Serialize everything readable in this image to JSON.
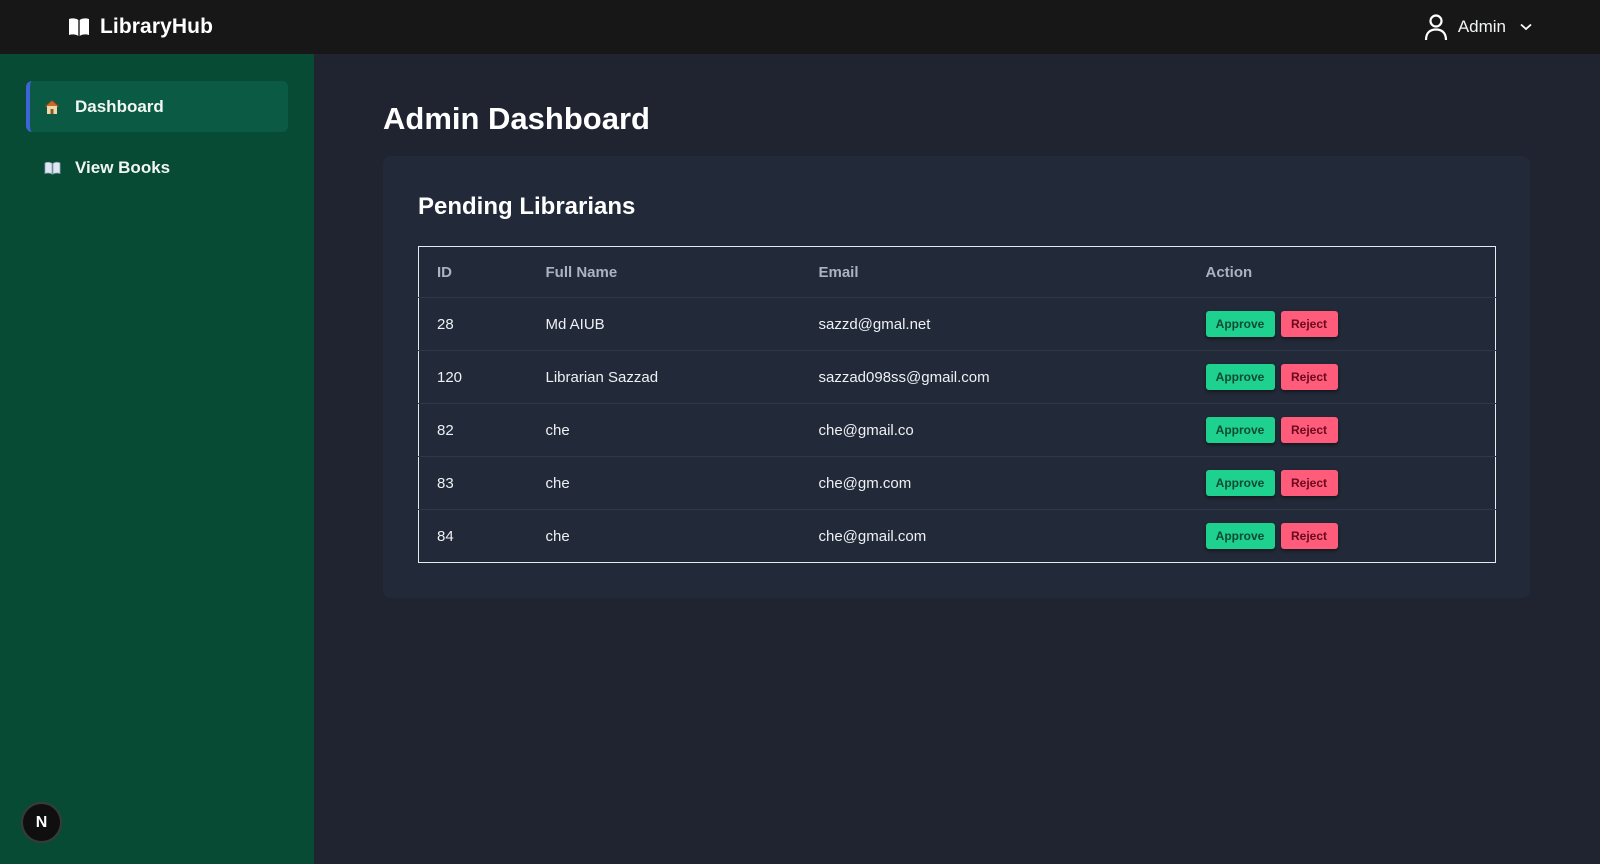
{
  "app": {
    "brand": "LibraryHub",
    "brand_icon": "open-book-icon"
  },
  "header": {
    "user_label": "Admin",
    "user_icon": "user-icon",
    "dropdown_icon": "chevron-down-icon"
  },
  "sidebar": {
    "items": [
      {
        "label": "Dashboard",
        "icon": "house-icon",
        "active": true
      },
      {
        "label": "View Books",
        "icon": "book-icon",
        "active": false
      }
    ],
    "badge": "N"
  },
  "main": {
    "title": "Admin Dashboard",
    "card_title": "Pending Librarians",
    "columns": [
      "ID",
      "Full Name",
      "Email",
      "Action"
    ],
    "rows": [
      {
        "id": "28",
        "name": "Md AIUB",
        "email": "sazzd@gmal.net"
      },
      {
        "id": "120",
        "name": "Librarian Sazzad",
        "email": "sazzad098ss@gmail.com"
      },
      {
        "id": "82",
        "name": "che",
        "email": "che@gmail.co"
      },
      {
        "id": "83",
        "name": "che",
        "email": "che@gm.com"
      },
      {
        "id": "84",
        "name": "che",
        "email": "che@gmail.com"
      }
    ],
    "approve_label": "Approve",
    "reject_label": "Reject"
  },
  "colors": {
    "topbar": "#171717",
    "sidebar": "#074b35",
    "sidebar_active": "#0b5b44",
    "active_accent": "#3f63d8",
    "background": "#1f2430",
    "card": "#222938",
    "approve": "#1fd18f",
    "reject": "#ff5b7a"
  }
}
